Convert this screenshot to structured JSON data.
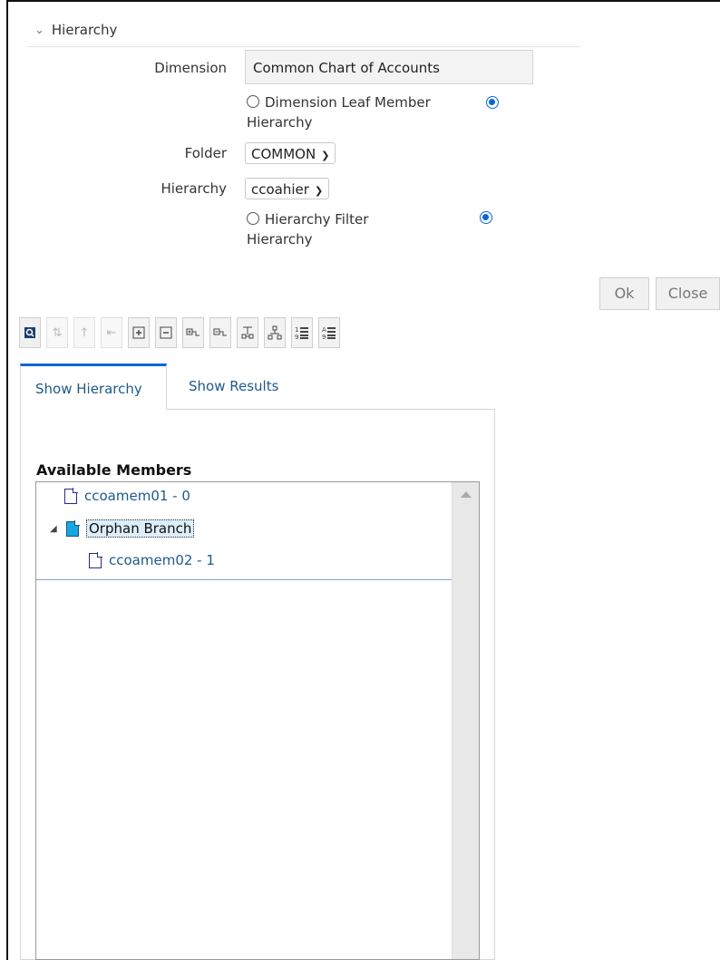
{
  "section": {
    "title": "Hierarchy"
  },
  "form": {
    "dimension_label": "Dimension",
    "dimension_value": "Common Chart of Accounts",
    "dim_radio_text": "Dimension Leaf Member",
    "dim_radio_text2": "Hierarchy",
    "folder_label": "Folder",
    "folder_value": "COMMON",
    "hierarchy_label": "Hierarchy",
    "hierarchy_value": "ccoahier",
    "hier_radio_text": "Hierarchy Filter",
    "hier_radio_text2": "Hierarchy"
  },
  "buttons": {
    "ok": "Ok",
    "close": "Close"
  },
  "toolbar": [
    "search-icon",
    "move-up-icon",
    "move-up-group-icon",
    "move-left-icon",
    "expand-all-icon",
    "collapse-all-icon",
    "expand-branch-icon",
    "collapse-branch-icon",
    "top-level-icon",
    "hierarchy-tree-icon",
    "sort-numeric-icon",
    "sort-alpha-icon"
  ],
  "tabs": {
    "show_hierarchy": "Show Hierarchy",
    "show_results": "Show Results"
  },
  "tree": {
    "title": "Available Members",
    "items": [
      "ccoamem01 - 0",
      "Orphan Branch",
      "ccoamem02 - 1"
    ]
  },
  "colors": {
    "accent": "#0a66d8",
    "link": "#1d5a8c",
    "branch_icon": "#16a7df"
  }
}
